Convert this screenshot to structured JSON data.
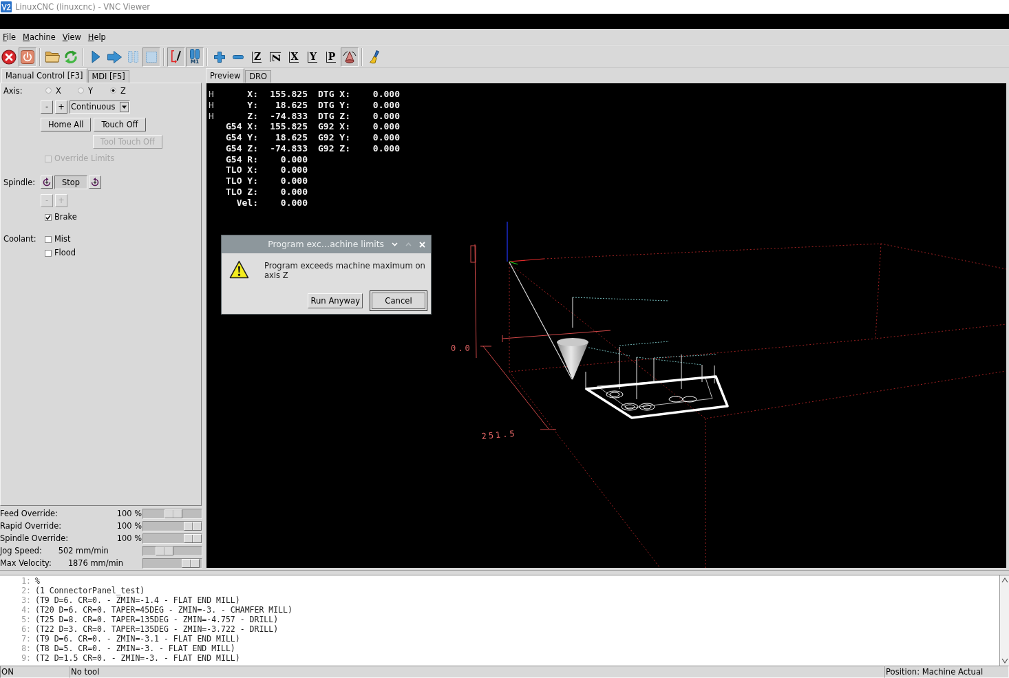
{
  "window": {
    "title": "LinuxCNC (linuxcnc) - VNC Viewer"
  },
  "menu": [
    "File",
    "Machine",
    "View",
    "Help"
  ],
  "toolbar": [
    {
      "kind": "estop",
      "pressed": false
    },
    {
      "kind": "power",
      "pressed": true
    },
    {
      "kind": "separator"
    },
    {
      "kind": "open",
      "pressed": false
    },
    {
      "kind": "reload",
      "pressed": false
    },
    {
      "kind": "separator"
    },
    {
      "kind": "run",
      "pressed": false
    },
    {
      "kind": "step",
      "pressed": false
    },
    {
      "kind": "pause",
      "pressed": false
    },
    {
      "kind": "stop",
      "pressed": true
    },
    {
      "kind": "separator"
    },
    {
      "kind": "block_delete",
      "pressed": true
    },
    {
      "kind": "optional_stop",
      "label": "M1",
      "pressed": true
    },
    {
      "kind": "separator"
    },
    {
      "kind": "zoom_in",
      "pressed": false
    },
    {
      "kind": "zoom_out",
      "pressed": false
    },
    {
      "kind": "view",
      "label": "Z",
      "pressed": false
    },
    {
      "kind": "view_rotated",
      "label": "Z",
      "pressed": false
    },
    {
      "kind": "view",
      "label": "X",
      "pressed": false
    },
    {
      "kind": "view",
      "label": "Y",
      "pressed": false
    },
    {
      "kind": "view",
      "label": "P",
      "pressed": false
    },
    {
      "kind": "perspective",
      "pressed": true
    },
    {
      "kind": "separator"
    },
    {
      "kind": "clear",
      "pressed": false
    }
  ],
  "left_tabs": [
    {
      "label": "Manual Control [F3]",
      "selected": true
    },
    {
      "label": "MDI [F5]",
      "selected": false
    }
  ],
  "manual_control": {
    "axis": {
      "label": "Axis:",
      "options": [
        {
          "label": "X",
          "selected": false
        },
        {
          "label": "Y",
          "selected": false
        },
        {
          "label": "Z",
          "selected": true
        }
      ]
    },
    "jog": {
      "buttons": [
        "-",
        "+"
      ],
      "mode": "Continuous"
    },
    "buttons": [
      {
        "label": "Home All",
        "disabled": false
      },
      {
        "label": "Touch Off",
        "disabled": false
      },
      {
        "label": "Tool Touch Off",
        "disabled": true
      }
    ],
    "override_limits": {
      "label": "Override Limits",
      "checked": false,
      "disabled": true
    },
    "spindle": {
      "label": "Spindle:",
      "buttons": [
        {
          "kind": "reverse",
          "pressed": false
        },
        {
          "kind": "stop",
          "label": "Stop",
          "pressed": true
        },
        {
          "kind": "forward",
          "pressed": false
        }
      ],
      "speed_buttons": [
        {
          "label": "-",
          "disabled": true
        },
        {
          "label": "+",
          "disabled": true
        }
      ],
      "brake": {
        "label": "Brake",
        "checked": true,
        "disabled": false
      }
    },
    "coolant": {
      "label": "Coolant:",
      "options": [
        {
          "label": "Mist",
          "checked": false,
          "disabled": false
        },
        {
          "label": "Flood",
          "checked": false,
          "disabled": false
        }
      ]
    }
  },
  "overrides": [
    {
      "kind": "percent",
      "label": "Feed Override:",
      "value": "100 %",
      "level": 0.52
    },
    {
      "kind": "percent",
      "label": "Rapid Override:",
      "value": "100 %",
      "level": 1
    },
    {
      "kind": "percent",
      "label": "Spindle Override:",
      "value": "100 %",
      "level": 1
    },
    {
      "kind": "speed",
      "label": "Jog Speed:",
      "value": "502 mm/min",
      "level": 0.3
    },
    {
      "kind": "speed",
      "label": "Max Velocity:",
      "value": "1876 mm/min",
      "level": 0.95
    }
  ],
  "right_tabs": [
    {
      "label": "Preview",
      "selected": true
    },
    {
      "label": "DRO",
      "selected": false
    }
  ],
  "preview": {
    "dro": [
      {
        "mark": "H",
        "label": "X:",
        "value": "155.825",
        "label_2": "DTG X:",
        "value_2": "0.000"
      },
      {
        "mark": "H",
        "label": "Y:",
        "value": "18.625",
        "label_2": "DTG Y:",
        "value_2": "0.000"
      },
      {
        "mark": "H",
        "label": "Z:",
        "value": "-74.833",
        "label_2": "DTG Z:",
        "value_2": "0.000"
      },
      {
        "label": "G54 X:",
        "value": "155.825",
        "label_2": "G92 X:",
        "value_2": "0.000"
      },
      {
        "label": "G54 Y:",
        "value": "18.625",
        "label_2": "G92 Y:",
        "value_2": "0.000"
      },
      {
        "label": "G54 Z:",
        "value": "-74.833",
        "label_2": "G92 Z:",
        "value_2": "0.000"
      },
      {
        "label": "G54 R:",
        "value": "0.000"
      },
      {
        "label": "TLO X:",
        "value": "0.000"
      },
      {
        "label": "TLO Y:",
        "value": "0.000"
      },
      {
        "label": "TLO Z:",
        "value": "0.000"
      },
      {
        "label": "Vel:",
        "value": "0.000"
      }
    ],
    "dimension_labels": [
      "0.0",
      "251.5"
    ],
    "dialog": {
      "title": "Program exc…achine limits",
      "message": "Program exceeds machine maximum on axis Z",
      "buttons": [
        {
          "label": "Run Anyway",
          "default": false
        },
        {
          "label": "Cancel",
          "default": true
        }
      ]
    }
  },
  "code": [
    {
      "number": "1:",
      "text": "%"
    },
    {
      "number": "2:",
      "text": "(1 ConnectorPanel_test)"
    },
    {
      "number": "3:",
      "text": "(T9 D=6. CR=0. - ZMIN=-1.4 - FLAT END MILL)"
    },
    {
      "number": "4:",
      "text": "(T20 D=6. CR=0. TAPER=45DEG - ZMIN=-3. - CHAMFER MILL)"
    },
    {
      "number": "5:",
      "text": "(T25 D=8. CR=0. TAPER=135DEG - ZMIN=-4.757 - DRILL)"
    },
    {
      "number": "6:",
      "text": "(T22 D=3. CR=0. TAPER=135DEG - ZMIN=-3.722 - DRILL)"
    },
    {
      "number": "7:",
      "text": "(T9 D=6. CR=0. - ZMIN=-3.1 - FLAT END MILL)"
    },
    {
      "number": "8:",
      "text": "(T8 D=5. CR=0. - ZMIN=-3. - FLAT END MILL)"
    },
    {
      "number": "9:",
      "text": "(T2 D=1.5 CR=0. - ZMIN=-3. - FLAT END MILL)"
    }
  ],
  "status_bar": [
    "ON",
    "No tool",
    "Position: Machine Actual"
  ]
}
